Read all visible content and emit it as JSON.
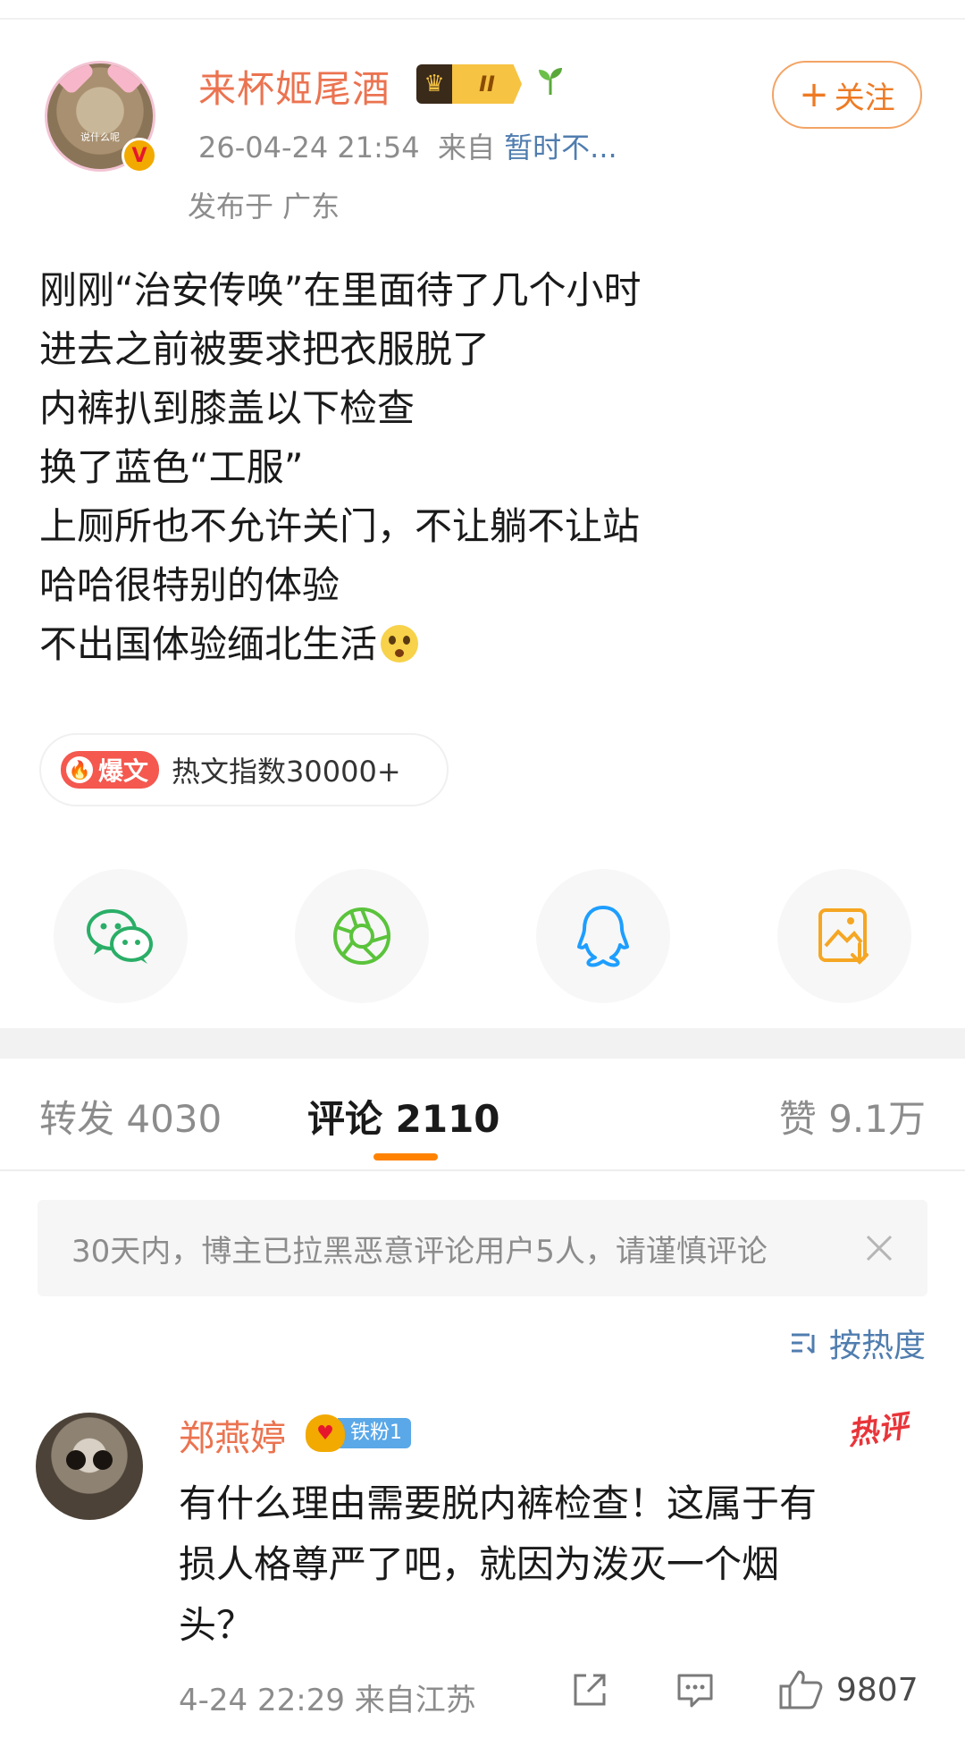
{
  "author": {
    "name": "来杯姬尾酒",
    "avatar_caption": "说什么呢",
    "level_badge": "II",
    "verified_mark": "V",
    "date_time": "26-04-24 21:54",
    "source_prefix": "来自",
    "source": "暂时不...",
    "location": "发布于 广东",
    "follow_plus": "+",
    "follow_label": "关注"
  },
  "post": {
    "lines": [
      "刚刚“治安传唤”在里面待了几个小时",
      "进去之前被要求把衣服脱了",
      "内裤扒到膝盖以下检查",
      "换了蓝色“工服”",
      "上厕所也不允许关门，不让躺不让站",
      "哈哈很特别的体验",
      "不出国体验缅北生活"
    ],
    "hot_tag": "爆文",
    "hot_index": "热文指数30000+"
  },
  "share": {
    "icons": [
      "wechat-icon",
      "moments-icon",
      "qq-icon",
      "save-image-icon"
    ],
    "colors": {
      "wechat": "#2aae67",
      "moments": "#5ac33b",
      "qq": "#1e9eff",
      "save": "#f5a623"
    }
  },
  "tabs": {
    "repost": "转发 4030",
    "comment": "评论 2110",
    "like": "赞 9.1万"
  },
  "notice": {
    "text": "30天内，博主已拉黑恶意评论用户5人，请谨慎评论"
  },
  "sort": {
    "label": "按热度"
  },
  "comment": {
    "name": "郑燕婷",
    "fan_badge": "铁粉1",
    "hot_mark": "热评",
    "lines": [
      "有什么理由需要脱内裤检查！这属于有",
      "损人格尊严了吧，就因为泼灭一个烟",
      "头？"
    ],
    "meta": "4-24 22:29 来自江苏",
    "likes": "9807"
  },
  "colors": {
    "accent": "#ff8200",
    "name_orange": "#eb7350",
    "link_blue": "#507daf"
  }
}
